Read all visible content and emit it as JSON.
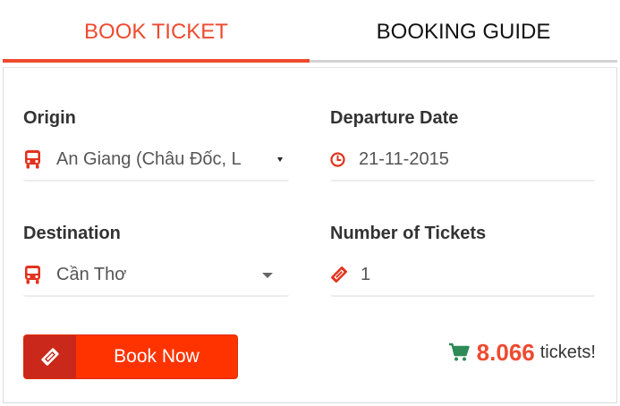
{
  "tabs": {
    "book_ticket": "BOOK TICKET",
    "booking_guide": "BOOKING GUIDE"
  },
  "form": {
    "origin": {
      "label": "Origin",
      "value": "An Giang (Châu Đốc, L",
      "icon": "bus-icon"
    },
    "departure_date": {
      "label": "Departure Date",
      "value": "21-11-2015",
      "icon": "clock-icon"
    },
    "destination": {
      "label": "Destination",
      "value": "Cần Thơ",
      "icon": "bus-icon"
    },
    "tickets": {
      "label": "Number of Tickets",
      "value": "1",
      "icon": "ticket-icon"
    }
  },
  "book_button": {
    "label": "Book Now",
    "icon": "ticket-icon"
  },
  "ticket_count": {
    "number": "8.066",
    "suffix": "tickets!",
    "icon": "cart-icon"
  },
  "colors": {
    "accent": "#ee4a2f",
    "button": "#ff3300",
    "button_icon_bg": "#c9281a",
    "cart": "#2e8b57"
  }
}
